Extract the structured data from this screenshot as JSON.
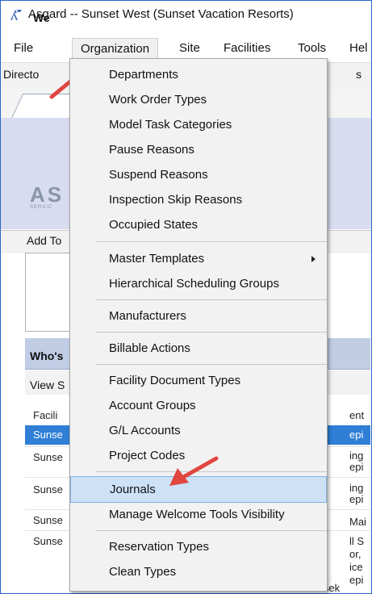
{
  "window": {
    "title": "Asgard -- Sunset West (Sunset Vacation Resorts)"
  },
  "menubar": {
    "items": [
      "File",
      "Organization",
      "Site",
      "Facilities",
      "Tools",
      "Hel"
    ]
  },
  "toolbar": {
    "left_text": "Directo",
    "right_text": "s"
  },
  "tab": {
    "label": "We"
  },
  "banner": {
    "logo": "AS",
    "logo_sub": "SERVIC"
  },
  "addbar": {
    "text": "Add To"
  },
  "whos_panel": {
    "header": "Who's",
    "view_label": "View S",
    "column_facility": "Facili",
    "column_right": "ent",
    "rows_left": [
      "Sunse",
      "Sunse",
      "Sunse",
      "Sunse",
      "Sunse"
    ],
    "rows_right": [
      "epi",
      "ing",
      "epi",
      "ing",
      "epi",
      "Mai",
      "ll S",
      "or,",
      "ice",
      "epi"
    ],
    "bottom_right": "Housek"
  },
  "organization_menu": {
    "items": [
      {
        "label": "Departments"
      },
      {
        "label": "Work Order Types"
      },
      {
        "label": "Model Task Categories"
      },
      {
        "label": "Pause Reasons"
      },
      {
        "label": "Suspend Reasons"
      },
      {
        "label": "Inspection Skip Reasons"
      },
      {
        "label": "Occupied States"
      },
      {
        "label": "Master Templates"
      },
      {
        "label": "Hierarchical Scheduling Groups"
      },
      {
        "label": "Manufacturers"
      },
      {
        "label": "Billable Actions"
      },
      {
        "label": "Facility Document Types"
      },
      {
        "label": "Account Groups"
      },
      {
        "label": "G/L Accounts"
      },
      {
        "label": "Project Codes"
      },
      {
        "label": "Journals"
      },
      {
        "label": "Manage Welcome Tools Visibility"
      },
      {
        "label": "Reservation Types"
      },
      {
        "label": "Clean Types"
      }
    ],
    "highlighted": "Journals",
    "highlight_color": "#cde2f7"
  },
  "annotations": {
    "arrow_color": "#e0463f"
  }
}
